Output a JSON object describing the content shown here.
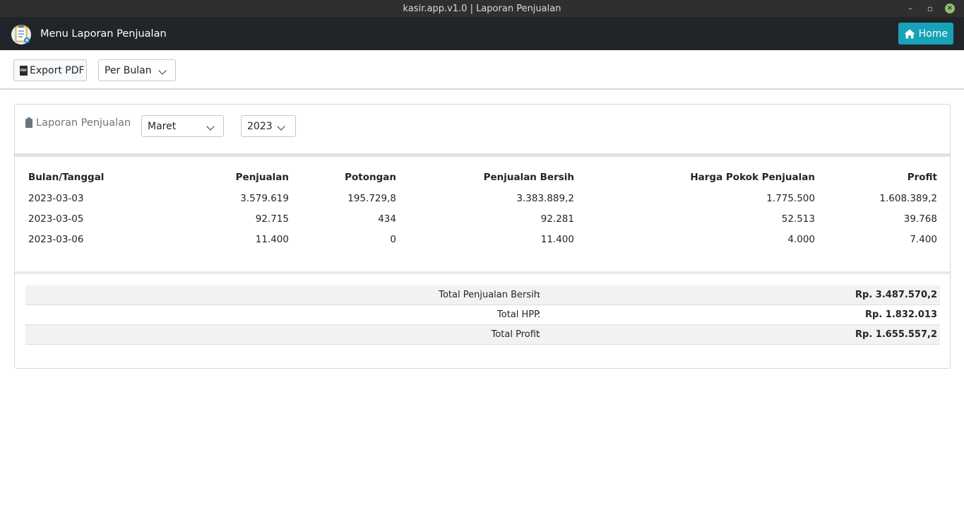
{
  "window": {
    "title": "kasir.app.v1.0 | Laporan Penjualan",
    "controls": {
      "minimize": "–",
      "restore": "▫",
      "close": "×"
    }
  },
  "header": {
    "title": "Menu Laporan Penjualan",
    "home_label": "Home",
    "accent_color": "#17a2b8"
  },
  "toolbar": {
    "export_label": "Export PDF",
    "period_selected": "Per Bulan"
  },
  "report": {
    "card_title": "Laporan Penjualan",
    "month_selected": "Maret",
    "year_selected": "2023",
    "columns": [
      "Bulan/Tanggal",
      "Penjualan",
      "Potongan",
      "Penjualan Bersih",
      "Harga Pokok Penjualan",
      "Profit"
    ],
    "rows": [
      [
        "2023-03-03",
        "3.579.619",
        "195.729,8",
        "3.383.889,2",
        "1.775.500",
        "1.608.389,2"
      ],
      [
        "2023-03-05",
        "92.715",
        "434",
        "92.281",
        "52.513",
        "39.768"
      ],
      [
        "2023-03-06",
        "11.400",
        "0",
        "11.400",
        "4.000",
        "7.400"
      ]
    ],
    "totals": [
      {
        "label": "Total Penjualan Bersih",
        "colon": ":",
        "value": "Rp. 3.487.570,2"
      },
      {
        "label": "Total HPP",
        "colon": ":",
        "value": "Rp. 1.832.013"
      },
      {
        "label": "Total Profit",
        "colon": ":",
        "value": "Rp. 1.655.557,2"
      }
    ]
  }
}
